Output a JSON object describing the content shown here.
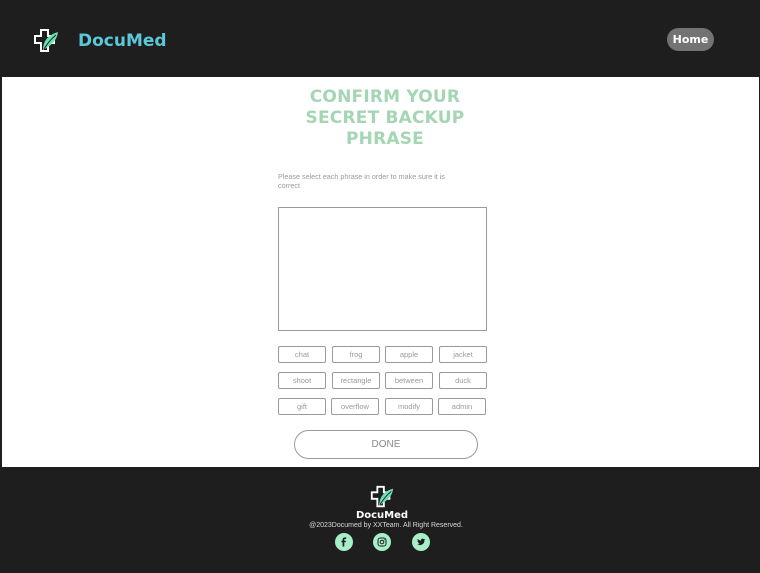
{
  "header": {
    "brand_name": "DocuMed",
    "logo_icon": "medical-cross-leaf-icon",
    "home_label": "Home"
  },
  "main": {
    "title": "CONFIRM YOUR SECRET BACKUP PHRASE",
    "instructions": "Please select each phrase in order to make sure it is correct",
    "phrase_box_value": "",
    "words": [
      "chat",
      "frog",
      "apple",
      "jacket",
      "shoot",
      "rectangle",
      "between",
      "duck",
      "gift",
      "overflow",
      "modify",
      "admin"
    ],
    "done_label": "DONE"
  },
  "footer": {
    "brand_name": "DocuMed",
    "copyright": "@2023Documed by XXTeam. All Right Reserved.",
    "social_icons": [
      "facebook-icon",
      "instagram-icon",
      "twitter-icon"
    ]
  },
  "colors": {
    "dark_bg": "#1e1e1e",
    "brand_teal": "#5ac8d8",
    "title_green": "#a4d6b3",
    "social_green": "#a6efc8",
    "home_button": "#737373"
  }
}
